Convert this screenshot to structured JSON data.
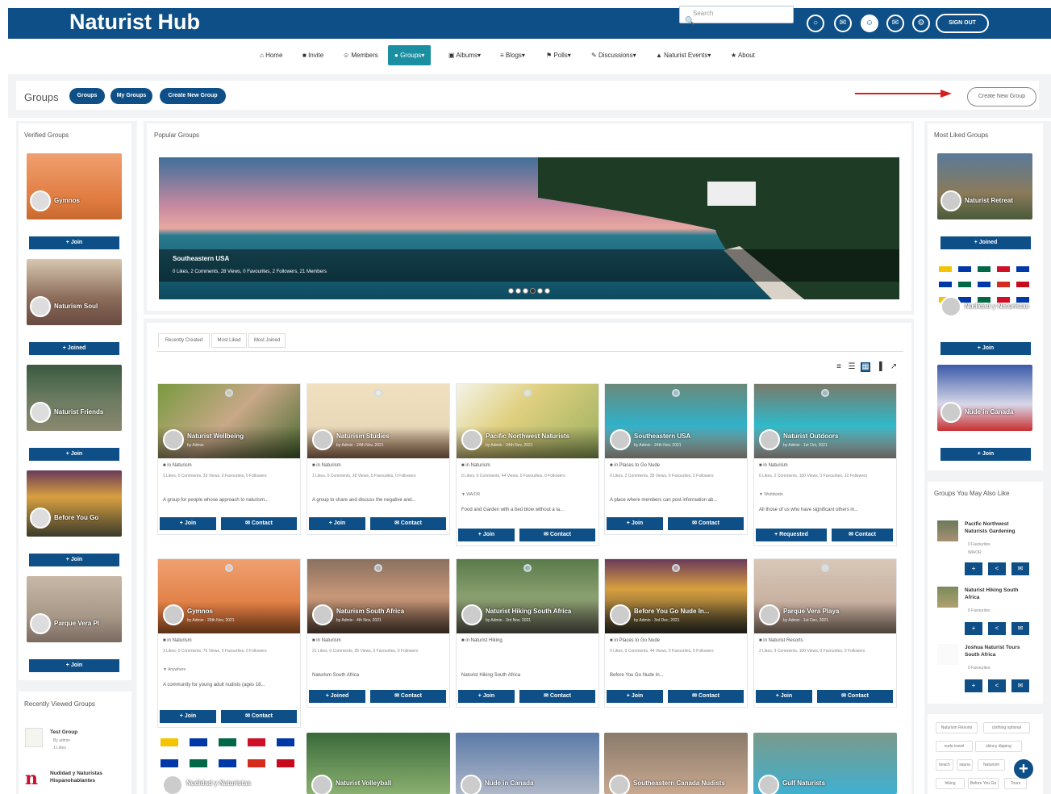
{
  "header": {
    "brand": "Naturist Hub",
    "search_placeholder": "Search",
    "sign_out": "SIGN OUT"
  },
  "nav": [
    {
      "icon": "home-icon",
      "label": "Home"
    },
    {
      "icon": "video-icon",
      "label": "Invite"
    },
    {
      "icon": "user-icon",
      "label": "Members"
    },
    {
      "icon": "groups-icon",
      "label": "Groups"
    },
    {
      "icon": "camera-icon",
      "label": "Albums"
    },
    {
      "icon": "list-icon",
      "label": "Blogs"
    },
    {
      "icon": "polls-icon",
      "label": "Polls"
    },
    {
      "icon": "discussions-icon",
      "label": "Discussions"
    },
    {
      "icon": "events-icon",
      "label": "Naturist Events"
    },
    {
      "icon": "star-icon",
      "label": "About"
    }
  ],
  "groups_bar": {
    "title": "Groups",
    "pills": [
      "Groups",
      "My Groups",
      "Create New Group"
    ],
    "create_button": "Create New Group"
  },
  "left": {
    "verified_title": "Verified Groups",
    "verified": [
      {
        "name": "Gymnos",
        "button": "+ Join"
      },
      {
        "name": "Naturism Soul",
        "button": "+ Joined"
      },
      {
        "name": "Naturist Friends",
        "button": "+ Join"
      },
      {
        "name": "Before You Go",
        "button": "+ Join"
      },
      {
        "name": "Parque Vera Pl",
        "button": "+ Join"
      }
    ],
    "recent_title": "Recently Viewed Groups",
    "recent": [
      {
        "name": "Test Group",
        "meta1": "By admin",
        "meta2": "1 Likes"
      },
      {
        "name": "Nudidad y Naturistas Hispanohablantes",
        "meta1": "",
        "meta2": ""
      }
    ]
  },
  "center": {
    "popular_title": "Popular Groups",
    "slide": {
      "title": "Southeastern USA",
      "meta": "0 Likes, 2 Comments, 28 Views, 0 Favourites, 2 Followers, 21 Members"
    },
    "tabs": [
      "Recently Created",
      "Most Liked",
      "Most Joined"
    ],
    "cards": [
      {
        "name": "Naturist Wellbeing",
        "by": "by Admin",
        "cat": "Naturism",
        "stats": "1 Likes, 0 Comments, 33 Views, 0 Favourites, 0 Followers",
        "loc": "",
        "desc": "A group for people whose approach to naturism...",
        "join": "+ Join",
        "contact": "Contact"
      },
      {
        "name": "Naturism Studies",
        "by": "by Admin · 24th Nov, 2021",
        "cat": "Naturism",
        "stats": "1 Likes, 0 Comments, 28 Views, 0 Favourites, 0 Followers",
        "loc": "",
        "desc": "A group to share and discuss the negative and...",
        "join": "+ Join",
        "contact": "Contact"
      },
      {
        "name": "Pacific Northwest Naturists",
        "by": "by Admin · 24th Nov, 2021",
        "cat": "Naturism",
        "stats": "0 Likes, 0 Comments, 44 Views, 0 Favourites, 0 Followers",
        "loc": "WA/OR",
        "desc": "Food and Garden with a bed blow without a la...",
        "join": "+ Join",
        "contact": "Contact"
      },
      {
        "name": "Southeastern USA",
        "by": "by Admin · 24th Nov, 2021",
        "cat": "Places to Go Nude",
        "stats": "0 Likes, 2 Comments, 28 Views, 0 Favourites, 2 Followers",
        "loc": "",
        "desc": "A place where members can post information ab...",
        "join": "+ Join",
        "contact": "Contact"
      },
      {
        "name": "Naturist Outdoors",
        "by": "by Admin · 1st Oct, 2021",
        "cat": "Naturism",
        "stats": "0 Likes, 2 Comments, 100 Views, 0 Favourites, 10 Followers",
        "loc": "Worldwide",
        "desc": "All those of us who have significant others in...",
        "join": "+ Requested",
        "contact": "Contact"
      },
      {
        "name": "Gymnos",
        "by": "by Admin · 29th Nov, 2021",
        "cat": "Naturism",
        "stats": "3 Likes, 0 Comments, 75 Views, 0 Favourites, 0 Followers",
        "loc": "Anywhere",
        "desc": "A community for young adult nudists (ages 18...",
        "join": "+ Join",
        "contact": "Contact"
      },
      {
        "name": "Naturism South Africa",
        "by": "by Admin · 4th Nov, 2021",
        "cat": "Naturism",
        "stats": "21 Likes, 0 Comments, 35 Views, 0 Favourites, 0 Followers",
        "loc": "",
        "desc": "Naturism South Africa",
        "join": "+ Joined",
        "contact": "Contact"
      },
      {
        "name": "Naturist Hiking South Africa",
        "by": "by Admin · 3rd Nov, 2021",
        "cat": "Naturist Hiking",
        "stats": "",
        "loc": "",
        "desc": "Naturist Hiking South Africa",
        "join": "+ Join",
        "contact": "Contact"
      },
      {
        "name": "Before You Go Nude In...",
        "by": "by Admin · 3rd Dec, 2021",
        "cat": "Places to Go Nude",
        "stats": "0 Likes, 0 Comments, 44 Views, 0 Favourites, 0 Followers",
        "loc": "",
        "desc": "Before You Go Nude In...",
        "join": "+ Join",
        "contact": "Contact"
      },
      {
        "name": "Parque Vera Playa",
        "by": "by Admin · 1st Dec, 2021",
        "cat": "Naturist Resorts",
        "stats": "2 Likes, 3 Comments, 100 Views, 0 Favourites, 0 Followers",
        "loc": "",
        "desc": "",
        "join": "+ Join",
        "contact": "Contact"
      }
    ],
    "row3": [
      "Nudidad y Naturistas",
      "Naturist Volleyball",
      "Nude in Canada",
      "Southeastern Canada Nudists",
      "Gulf Naturists"
    ]
  },
  "right": {
    "liked_title": "Most Liked Groups",
    "liked": [
      {
        "name": "Naturist Retreat",
        "button": "+ Joined"
      },
      {
        "name": "Nudidad y Naturistas",
        "button": "+ Join"
      },
      {
        "name": "Nude in Canada",
        "button": "+ Join"
      }
    ],
    "may_like_title": "Groups You May Also Like",
    "may_like": [
      {
        "name": "Pacific Northwest Naturists Gardening",
        "m1": "0 Favourites",
        "m2": "WA/OR"
      },
      {
        "name": "Naturist Hiking South Africa",
        "m1": "0 Favourites",
        "m2": ""
      },
      {
        "name": "Joshua Naturist Tours South Africa",
        "m1": "0 Favourites",
        "m2": ""
      }
    ],
    "tags": [
      "Naturism Resorts",
      "clothing optional",
      "nude travel",
      "skinny dipping",
      "beach",
      "sauna",
      "Naturism",
      "hiking",
      "Before You Go",
      "Tours"
    ]
  }
}
